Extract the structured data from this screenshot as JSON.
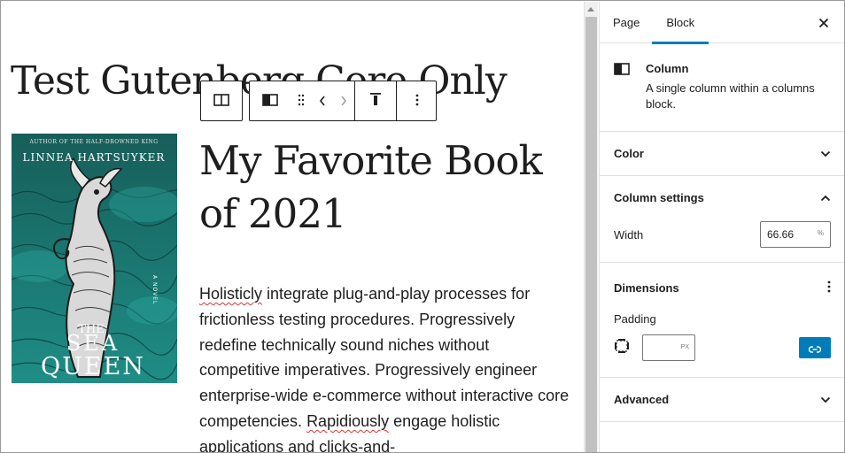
{
  "editor": {
    "page_title": "Test Gutenberg Core Only",
    "book_heading": "My Favorite Book of 2021",
    "cover_image": {
      "author": "LINNEA HARTSUYKER",
      "tagline": "AUTHOR OF THE HALF-DROWNED KING",
      "title_line1": "THE",
      "title_line2": "SEA",
      "title_line3": "QUEEN",
      "genre": "A NOVEL"
    },
    "paragraph": {
      "w1": "Holisticly",
      "t1": " integrate plug-and-play processes for frictionless testing procedures. Progressively redefine technically sound niches without competitive imperatives. Progressively engineer enterprise-wide e-commerce without interactive core competencies. ",
      "w2": "Rapidiously",
      "t2": " engage holistic applications and clicks-and-"
    }
  },
  "toolbar": {
    "select_parent_icon": "columns-icon",
    "block_type_icon": "column-icon",
    "drag_icon": "drag-handle-icon",
    "move_left_icon": "chevron-left-icon",
    "move_right_icon": "chevron-right-icon",
    "align_icon": "vertical-align-top-icon",
    "options_icon": "more-vertical-icon"
  },
  "sidebar": {
    "tabs": [
      {
        "label": "Page",
        "active": false
      },
      {
        "label": "Block",
        "active": true
      }
    ],
    "close_icon": "close-icon",
    "block_card": {
      "title": "Column",
      "description": "A single column within a columns block."
    },
    "panels": {
      "color": {
        "title": "Color",
        "open": false
      },
      "column_settings": {
        "title": "Column settings",
        "open": true,
        "width_label": "Width",
        "width_value": "66.66",
        "width_unit": "%"
      },
      "dimensions": {
        "title": "Dimensions",
        "padding_label": "Padding",
        "padding_value": "",
        "padding_unit": "PX"
      },
      "advanced": {
        "title": "Advanced",
        "open": false
      }
    }
  },
  "colors": {
    "accent": "#007cba",
    "text": "#1e1e1e",
    "border": "#e0e0e0",
    "cover_teal": "#1a7f7a",
    "spellcheck": "#d63638"
  }
}
